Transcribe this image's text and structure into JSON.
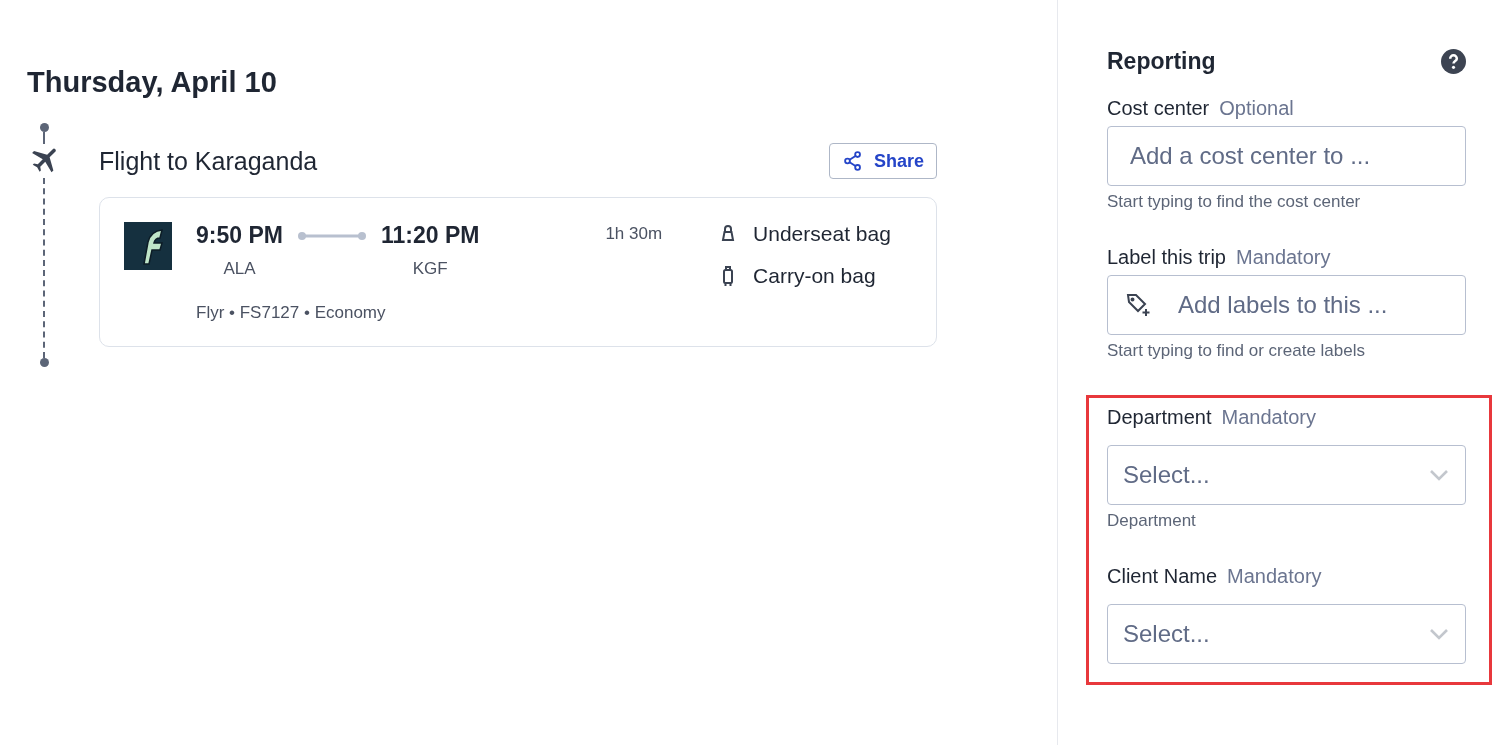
{
  "day": {
    "date": "Thursday, April 10"
  },
  "flight": {
    "title": "Flight to Karaganda",
    "share_button": "Share",
    "departure": {
      "time": "9:50 PM",
      "airport": "ALA"
    },
    "arrival": {
      "time": "11:20 PM",
      "airport": "KGF"
    },
    "duration": "1h 30m",
    "details": "Flyr • FS7127 • Economy",
    "bags": [
      {
        "kind": "underseat",
        "label": "Underseat bag"
      },
      {
        "kind": "carryon",
        "label": "Carry-on bag"
      }
    ]
  },
  "reporting": {
    "title": "Reporting",
    "fields": [
      {
        "kind": "text",
        "label": "Cost center",
        "requirement": "Optional",
        "placeholder": "Add a cost center to ...",
        "hint": "Start typing to find the cost center",
        "highlighted": false
      },
      {
        "kind": "tags",
        "label": "Label this trip",
        "requirement": "Mandatory",
        "placeholder": "Add labels to this ...",
        "hint": "Start typing to find or create labels",
        "highlighted": false
      },
      {
        "kind": "select",
        "label": "Department",
        "requirement": "Mandatory",
        "placeholder": "Select...",
        "hint": "Department",
        "highlighted": true
      },
      {
        "kind": "select",
        "label": "Client Name",
        "requirement": "Mandatory",
        "placeholder": "Select...",
        "highlighted": true
      }
    ]
  }
}
